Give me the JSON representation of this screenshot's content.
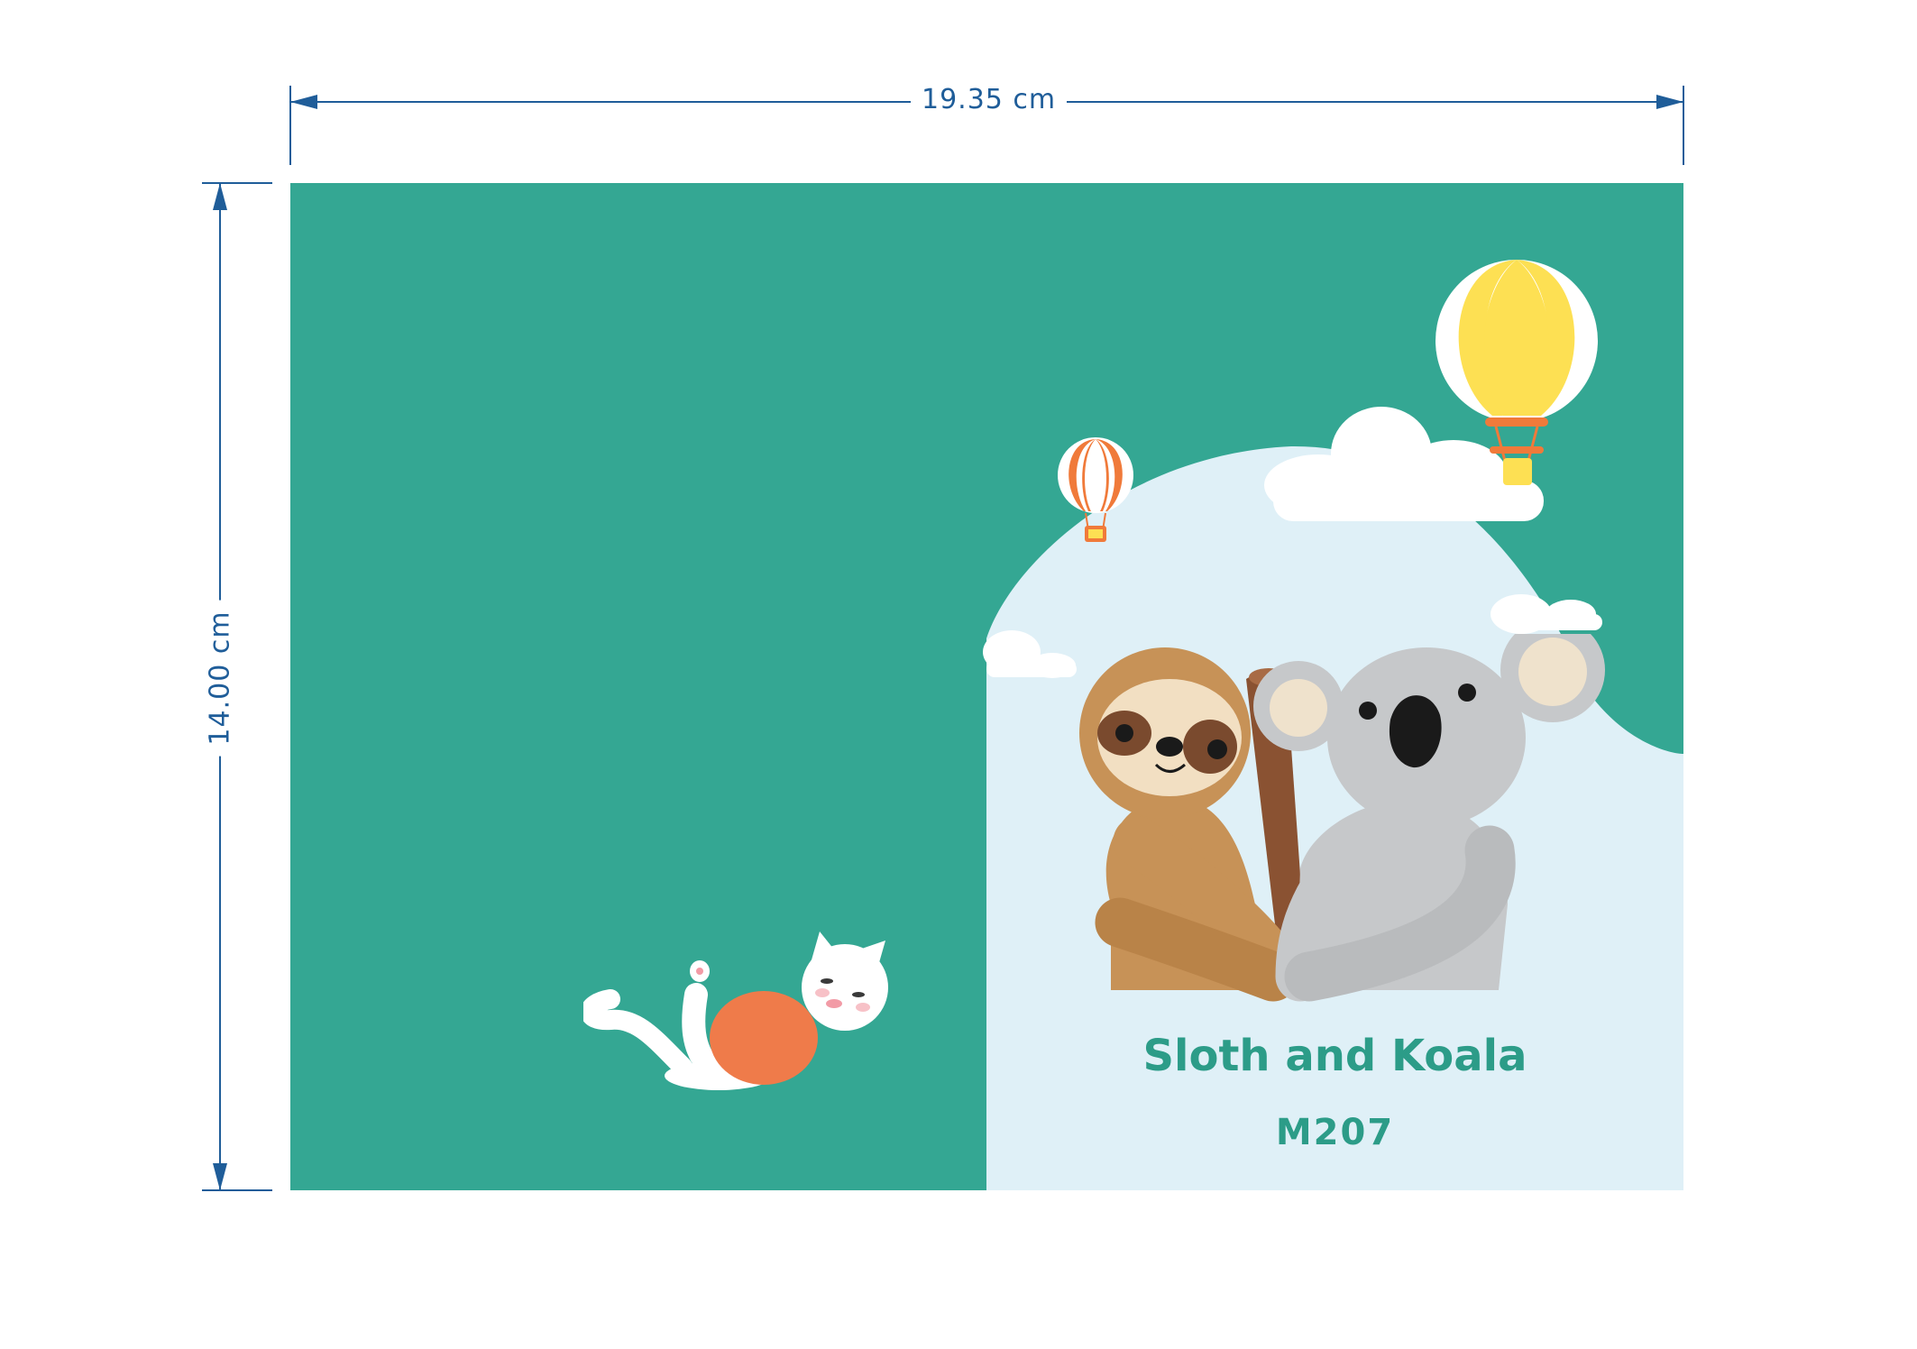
{
  "dimensions": {
    "width_label": "19.35 cm",
    "height_label": "14.00 cm",
    "line_color": "#1f5d99"
  },
  "cover": {
    "background_color": "#34a793",
    "front_panel_color": "#dff0f7",
    "title": "Sloth and Koala",
    "code": "M207",
    "title_color": "#2c9c88"
  },
  "illustrations": [
    "large-yellow-hot-air-balloon",
    "small-orange-hot-air-balloon",
    "clouds",
    "crochet-sloth-and-koala",
    "sleeping-white-cat"
  ]
}
